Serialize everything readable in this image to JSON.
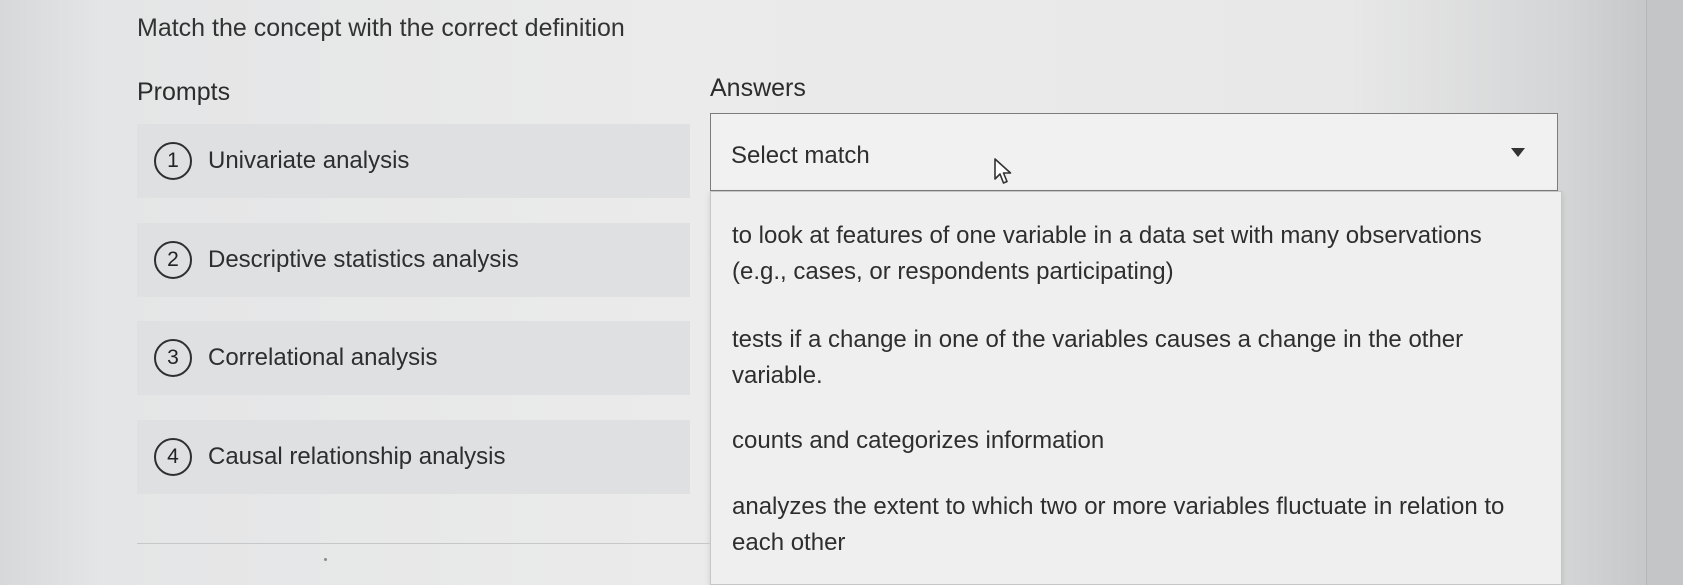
{
  "instruction": "Match the concept with the correct definition",
  "prompts_heading": "Prompts",
  "answers_heading": "Answers",
  "prompts": [
    {
      "number": "1",
      "label": "Univariate analysis"
    },
    {
      "number": "2",
      "label": "Descriptive statistics analysis"
    },
    {
      "number": "3",
      "label": "Correlational analysis"
    },
    {
      "number": "4",
      "label": "Causal relationship analysis"
    }
  ],
  "select": {
    "placeholder": "Select match",
    "icon": "caret-down-icon"
  },
  "options": [
    "to look at features of one variable in a data set with many observations (e.g., cases, or respondents participating)",
    "tests if a change in one of the variables causes a change in the other variable.",
    "counts and categorizes information",
    "analyzes the extent to which two or more variables fluctuate in relation to each other"
  ],
  "cursor_icon": "mouse-pointer-icon"
}
